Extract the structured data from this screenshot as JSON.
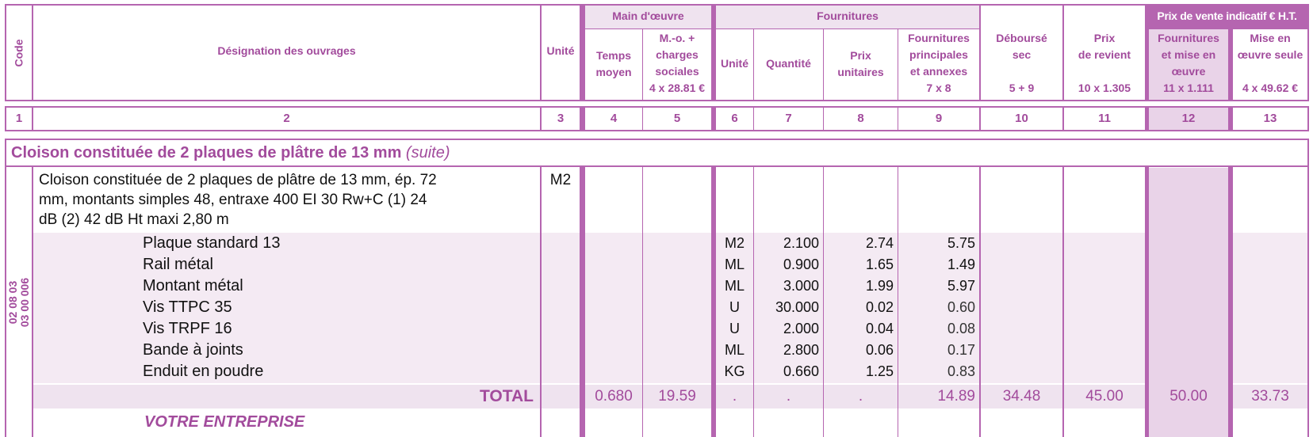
{
  "header": {
    "code": "Code",
    "designation": "Désignation des ouvrages",
    "unite": "Unité",
    "main_oeuvre": "Main d'œuvre",
    "fournitures": "Fournitures",
    "prix_vente": "Prix de vente indicatif € H.T.",
    "temps_moyen": [
      "Temps",
      "moyen"
    ],
    "mo_charges": [
      "M.-o. +",
      "charges",
      "sociales",
      "4 x 28.81 €"
    ],
    "f_unite": "Unité",
    "f_quantite": "Quantité",
    "f_prix_unitaires": [
      "Prix",
      "unitaires"
    ],
    "f_principales": [
      "Fournitures",
      "principales",
      "et annexes",
      "7 x 8"
    ],
    "debourse_sec": [
      "Déboursé",
      "sec",
      "5 + 9"
    ],
    "prix_revient": [
      "Prix",
      "de revient",
      "10 x 1.305"
    ],
    "fournitures_mise": [
      "Fournitures",
      "et mise en",
      "œuvre",
      "11 x 1.111"
    ],
    "mise_oeuvre_seule": [
      "Mise en",
      "œuvre seule",
      "4 x 49.62 €"
    ]
  },
  "column_numbers": [
    "1",
    "2",
    "3",
    "4",
    "5",
    "6",
    "7",
    "8",
    "9",
    "10",
    "11",
    "12",
    "13"
  ],
  "section": {
    "title": "Cloison constituée de 2 plaques de plâtre de 13 mm",
    "suite": "(suite)"
  },
  "item": {
    "code": [
      "02 08 03",
      "03 00 006"
    ],
    "description": [
      "Cloison constituée de 2 plaques de plâtre de 13 mm, ép. 72",
      "mm, montants simples 48, entraxe 400 EI 30 Rw+C (1) 24",
      "dB (2) 42 dB Ht maxi 2,80 m"
    ],
    "unit": "M2"
  },
  "materials": [
    {
      "name": "Plaque standard 13",
      "unit": "M2",
      "qty": "2.100",
      "pu": "2.74",
      "total": "5.75"
    },
    {
      "name": "Rail métal",
      "unit": "ML",
      "qty": "0.900",
      "pu": "1.65",
      "total": "1.49"
    },
    {
      "name": "Montant métal",
      "unit": "ML",
      "qty": "3.000",
      "pu": "1.99",
      "total": "5.97"
    },
    {
      "name": "Vis TTPC 35",
      "unit": "U",
      "qty": "30.000",
      "pu": "0.02",
      "total": "0.60"
    },
    {
      "name": "Vis TRPF 16",
      "unit": "U",
      "qty": "2.000",
      "pu": "0.04",
      "total": "0.08"
    },
    {
      "name": "Bande à joints",
      "unit": "ML",
      "qty": "2.800",
      "pu": "0.06",
      "total": "0.17"
    },
    {
      "name": "Enduit en poudre",
      "unit": "KG",
      "qty": "0.660",
      "pu": "1.25",
      "total": "0.83"
    }
  ],
  "total": {
    "label": "TOTAL",
    "c4": "0.680",
    "c5": "19.59",
    "c6": ".",
    "c7": ".",
    "c8": ".",
    "c9": "14.89",
    "c10": "34.48",
    "c11": "45.00",
    "c12": "50.00",
    "c13": "33.73"
  },
  "votre_entreprise": "VOTRE ENTREPRISE",
  "colors": {
    "accent": "#a24b9c",
    "line": "#b565b0",
    "band": "#f4eaf3",
    "shade": "#e9d3e8",
    "header_bg": "#efe3ef"
  }
}
